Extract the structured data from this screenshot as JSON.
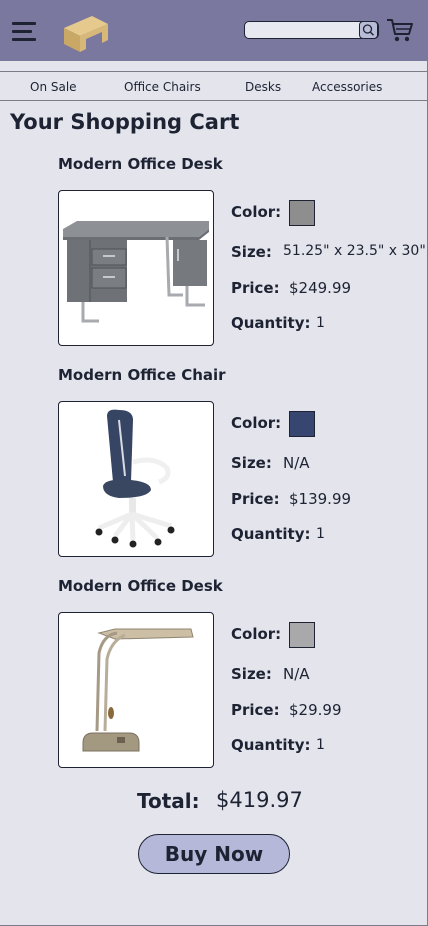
{
  "colors": {
    "header_bg": "#7b789f",
    "page_bg": "#e3e4ec",
    "button_bg": "#b5b8d8",
    "text": "#1d2333"
  },
  "header": {
    "menu_icon": "hamburger-menu-icon",
    "logo_icon": "desk-logo-icon",
    "search": {
      "placeholder": "",
      "value": "",
      "button_icon": "search-icon"
    },
    "cart_icon": "shopping-cart-icon"
  },
  "nav": {
    "items": [
      "On Sale",
      "Office Chairs",
      "Desks",
      "Accessories"
    ]
  },
  "page": {
    "title": "Your Shopping Cart"
  },
  "labels": {
    "color": "Color:",
    "size": "Size:",
    "price": "Price:",
    "quantity": "Quantity:"
  },
  "cart": {
    "items": [
      {
        "title": "Modern Office Desk",
        "image": "gray-office-desk-image",
        "color_swatch": "#8e8e8e",
        "size": "51.25\" x 23.5\" x 30\"",
        "price": "$249.99",
        "quantity": "1"
      },
      {
        "title": "Modern Office Chair",
        "image": "navy-office-chair-image",
        "color_swatch": "#364670",
        "size": "N/A",
        "price": "$139.99",
        "quantity": "1"
      },
      {
        "title": "Modern Office Desk",
        "image": "brass-desk-lamp-image",
        "color_swatch": "#a9a9ab",
        "size": "N/A",
        "price": "$29.99",
        "quantity": "1"
      }
    ]
  },
  "summary": {
    "total_label": "Total:",
    "total_value": "$419.97",
    "buy_button": "Buy Now"
  }
}
